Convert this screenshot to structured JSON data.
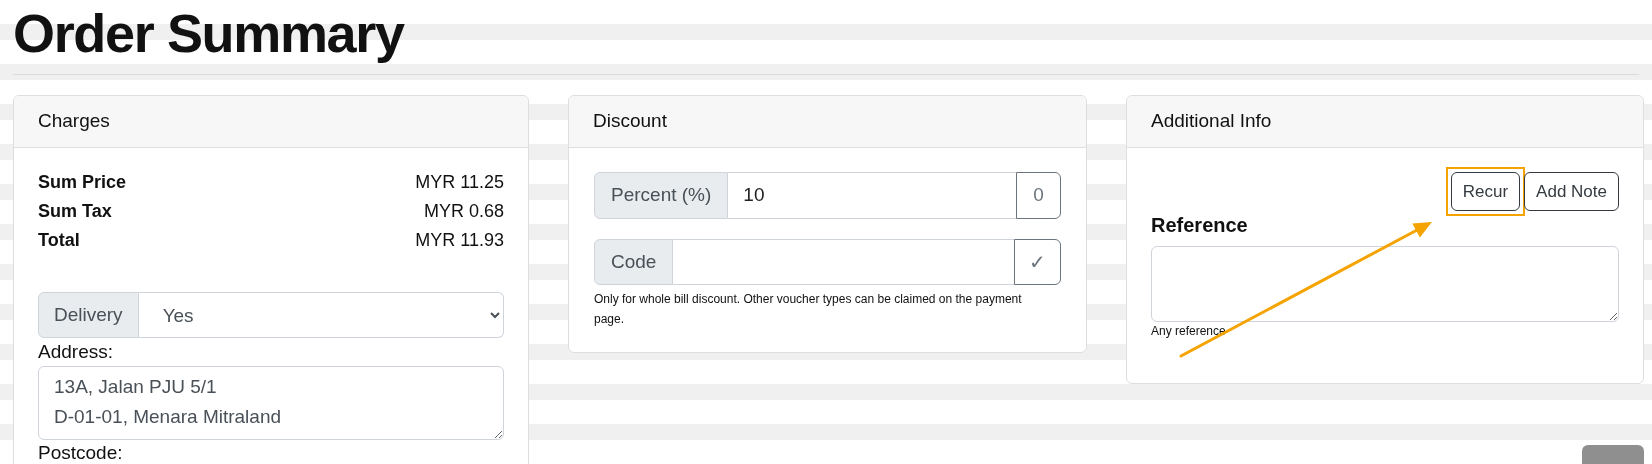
{
  "page_title": "Order Summary",
  "charges": {
    "title": "Charges",
    "lines": [
      {
        "label": "Sum Price",
        "value": "MYR 11.25"
      },
      {
        "label": "Sum Tax",
        "value": "MYR 0.68"
      },
      {
        "label": "Total",
        "value": "MYR 11.93"
      }
    ],
    "delivery": {
      "label": "Delivery",
      "value": "Yes"
    },
    "address": {
      "label": "Address:",
      "lines": [
        "13A, Jalan PJU 5/1",
        "D-01-01, Menara Mitraland"
      ]
    },
    "postcode_label": "Postcode:"
  },
  "discount": {
    "title": "Discount",
    "percent": {
      "label": "Percent (%)",
      "value": "10",
      "addon": "0"
    },
    "code": {
      "label": "Code",
      "addon": "✓"
    },
    "help": "Only for whole bill discount. Other voucher types can be claimed on the payment page."
  },
  "additional_info": {
    "title": "Additional Info",
    "buttons": [
      {
        "label": "Recur",
        "highlighted": true
      },
      {
        "label": "Add Note",
        "highlighted": false
      }
    ],
    "reference": {
      "label": "Reference",
      "help": "Any reference"
    }
  }
}
